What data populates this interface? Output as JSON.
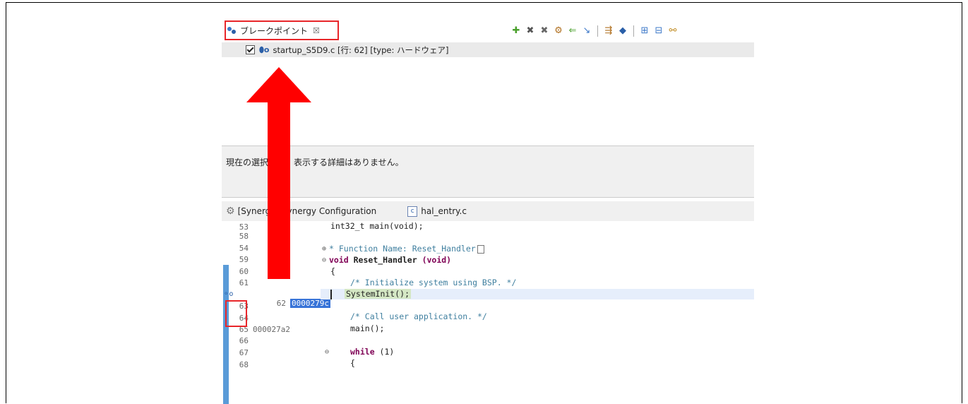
{
  "breakpoints_view": {
    "tab_label": "ブレークポイント",
    "close_glyph": "☒",
    "toolbar_icons": [
      "add-icon",
      "remove-icon",
      "remove-all-icon",
      "link-icon",
      "go-to-file-icon",
      "skip-icon",
      "collapse-icon",
      "expand-icon",
      "group-icon"
    ],
    "rows": [
      {
        "checked": true,
        "label": "startup_S5D9.c [行: 62] [type: ハードウェア]"
      }
    ]
  },
  "details_text": "現在の選択では、表示する詳細はありません。",
  "editor_tabs": [
    {
      "label": "[Synergy] Synergy Configuration"
    },
    {
      "label": "hal_entry.c",
      "file_icon": "c"
    }
  ],
  "gutter": [
    {
      "num": "53",
      "addr": ""
    },
    {
      "num": "58",
      "addr": ""
    },
    {
      "num": "54",
      "addr": ""
    },
    {
      "num": "59",
      "addr": ""
    },
    {
      "num": "60",
      "addr": ""
    },
    {
      "num": "61",
      "addr": ""
    },
    {
      "num": "62",
      "addr": "0000279c"
    },
    {
      "num": "63",
      "addr": ""
    },
    {
      "num": "64",
      "addr": ""
    },
    {
      "num": "65",
      "addr": "000027a2"
    },
    {
      "num": "66",
      "addr": ""
    },
    {
      "num": "67",
      "addr": ""
    },
    {
      "num": "68",
      "addr": ""
    }
  ],
  "code": {
    "l1": "int32_t main(void);",
    "l2": "* Function Name: Reset_Handler",
    "l3_kw": "void",
    "l3_fn": " Reset_Handler",
    "l3_rest": " (void)",
    "l4": "{",
    "l5": "/* Initialize system using BSP. */",
    "l6": "SystemInit();",
    "l7": "/* Call user application. */",
    "l8": "main();",
    "l9_kw": "while",
    "l9_rest": " (1)",
    "l10": "{"
  },
  "colors": {
    "highlight_box": "#e8262a",
    "arrow": "#ff0000",
    "selection": "#3874d8",
    "ruler": "#5a9bd8"
  }
}
